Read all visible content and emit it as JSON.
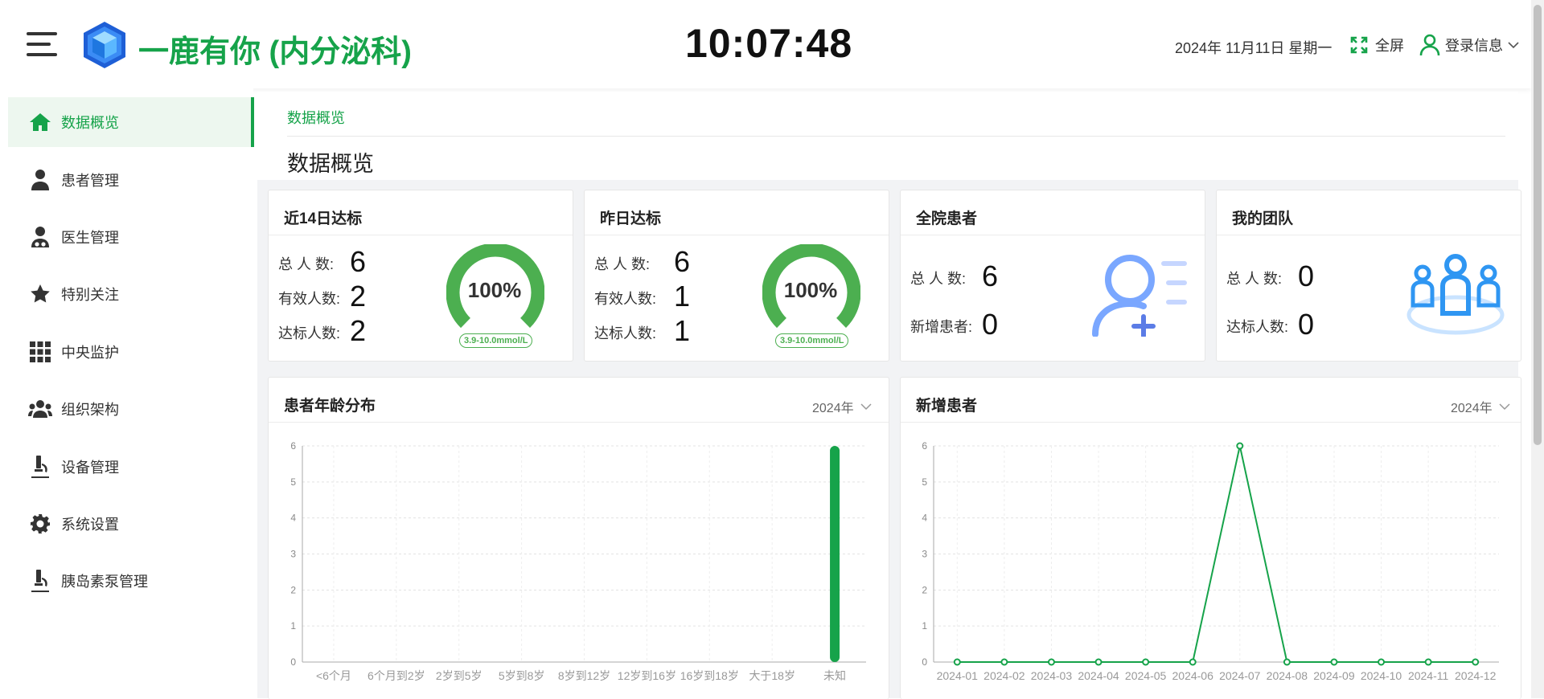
{
  "header": {
    "app_title": "一鹿有你 (内分泌科)",
    "clock": "10:07:48",
    "date": "2024年 11月11日 星期一",
    "fullscreen_label": "全屏",
    "login_label": "登录信息"
  },
  "sidebar": {
    "items": [
      {
        "label": "数据概览",
        "icon": "home-icon"
      },
      {
        "label": "患者管理",
        "icon": "user-icon"
      },
      {
        "label": "医生管理",
        "icon": "doctor-icon"
      },
      {
        "label": "特别关注",
        "icon": "star-icon"
      },
      {
        "label": "中央监护",
        "icon": "grid-icon"
      },
      {
        "label": "组织架构",
        "icon": "users-icon"
      },
      {
        "label": "设备管理",
        "icon": "microscope-icon"
      },
      {
        "label": "系统设置",
        "icon": "gear-icon"
      },
      {
        "label": "胰岛素泵管理",
        "icon": "microscope-icon"
      }
    ]
  },
  "breadcrumb": "数据概览",
  "page_title": "数据概览",
  "cards": {
    "recent14": {
      "title": "近14日达标",
      "total_label": "总 人 数:",
      "total": "6",
      "valid_label": "有效人数:",
      "valid": "2",
      "reach_label": "达标人数:",
      "reach": "2",
      "gauge_text": "100%",
      "gauge_value": 1.0,
      "range": "3.9-10.0mmol/L"
    },
    "yesterday": {
      "title": "昨日达标",
      "total_label": "总 人 数:",
      "total": "6",
      "valid_label": "有效人数:",
      "valid": "1",
      "reach_label": "达标人数:",
      "reach": "1",
      "gauge_text": "100%",
      "gauge_value": 1.0,
      "range": "3.9-10.0mmol/L"
    },
    "hospital": {
      "title": "全院患者",
      "total_label": "总 人 数:",
      "total": "6",
      "new_label": "新增患者:",
      "new": "0"
    },
    "team": {
      "title": "我的团队",
      "total_label": "总 人 数:",
      "total": "0",
      "reach_label": "达标人数:",
      "reach": "0"
    }
  },
  "colors": {
    "accent": "#16a34a",
    "gauge": "#4caf50",
    "icon_blue": "#7aa7ff"
  },
  "charts": {
    "age": {
      "title": "患者年龄分布",
      "year": "2024年"
    },
    "new": {
      "title": "新增患者",
      "year": "2024年"
    }
  },
  "chart_data": [
    {
      "type": "bar",
      "categories": [
        "<6个月",
        "6个月到2岁",
        "2岁到5岁",
        "5岁到8岁",
        "8岁到12岁",
        "12岁到16岁",
        "16岁到18岁",
        "大于18岁",
        "未知"
      ],
      "values": [
        0,
        0,
        0,
        0,
        0,
        0,
        0,
        0,
        6
      ],
      "ylim": [
        0,
        6
      ],
      "yticks": [
        0,
        1,
        2,
        3,
        4,
        5,
        6
      ],
      "grid": true
    },
    {
      "type": "line",
      "categories": [
        "2024-01",
        "2024-02",
        "2024-03",
        "2024-04",
        "2024-05",
        "2024-06",
        "2024-07",
        "2024-08",
        "2024-09",
        "2024-10",
        "2024-11",
        "2024-12"
      ],
      "values": [
        0,
        0,
        0,
        0,
        0,
        0,
        6,
        0,
        0,
        0,
        0,
        0
      ],
      "ylim": [
        0,
        6
      ],
      "yticks": [
        0,
        1,
        2,
        3,
        4,
        5,
        6
      ],
      "grid": true
    }
  ]
}
